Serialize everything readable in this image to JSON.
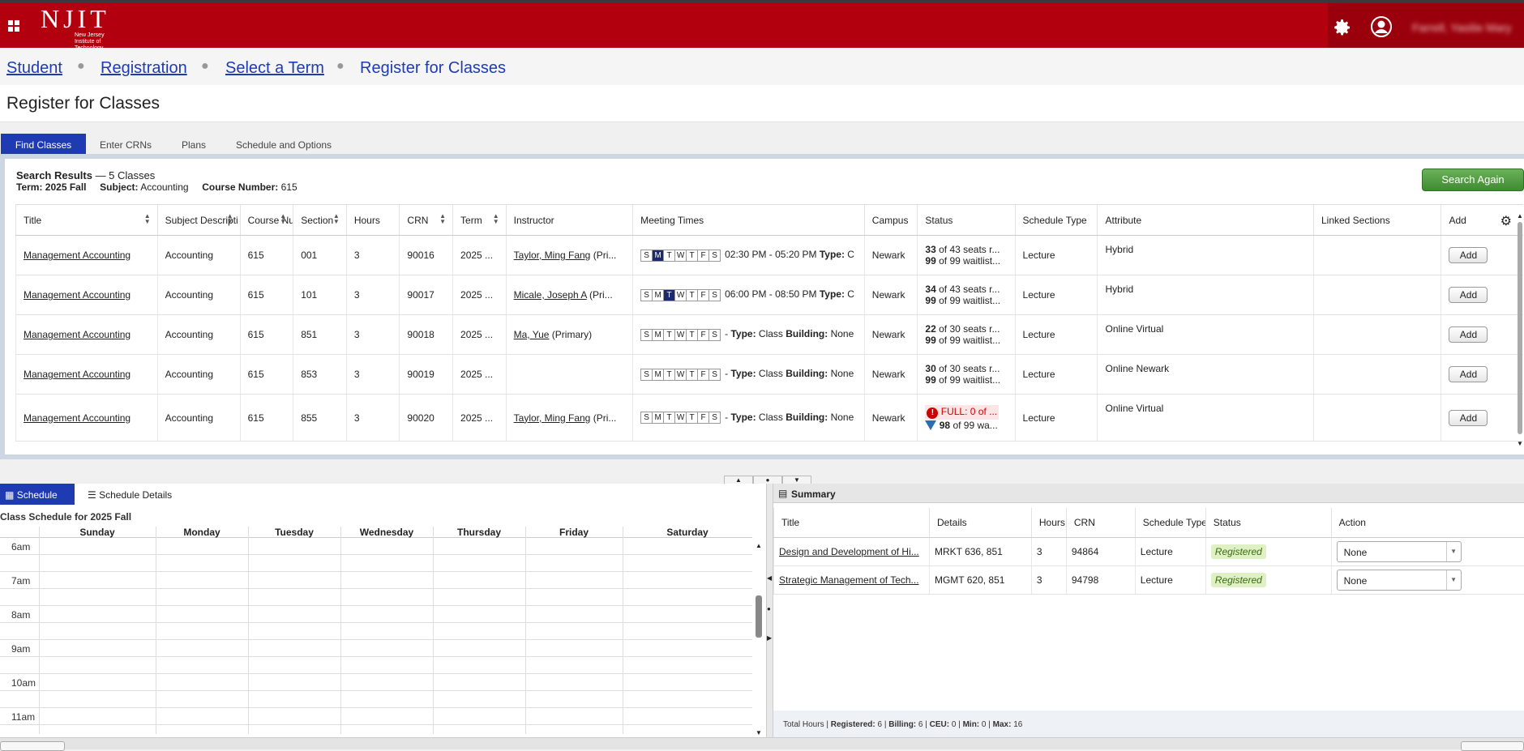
{
  "header": {
    "logo_text": "NJIT",
    "logo_subtext": "New Jersey Institute of Technology",
    "user_name": "Farrell, Yasilie Mary",
    "icons": [
      "apps-grid-icon",
      "gear-icon",
      "user-icon"
    ]
  },
  "breadcrumb": {
    "items": [
      "Student",
      "Registration",
      "Select a Term",
      "Register for Classes"
    ]
  },
  "page_title": "Register for Classes",
  "tabs": [
    "Find Classes",
    "Enter CRNs",
    "Plans",
    "Schedule and Options"
  ],
  "results": {
    "title": "Search Results",
    "count": "— 5 Classes",
    "term_label": "Term:",
    "term_value": "2025 Fall",
    "subject_label": "Subject:",
    "subject_value": "Accounting",
    "course_label": "Course Number:",
    "course_value": "615",
    "search_again": "Search Again",
    "columns": [
      "Title",
      "Subject Descripti",
      "Course Nu",
      "Section",
      "Hours",
      "CRN",
      "Term",
      "Instructor",
      "Meeting Times",
      "Campus",
      "Status",
      "Schedule Type",
      "Attribute",
      "Linked Sections",
      "Add"
    ],
    "rows": [
      {
        "title": "Management Accounting",
        "subject": "Accounting",
        "course": "615",
        "section": "001",
        "hours": "3",
        "crn": "90016",
        "term": "2025 ...",
        "instructor": "Taylor, Ming Fang",
        "instructor_role": "(Pri...",
        "days_on": [
          "M"
        ],
        "meeting": "02:30 PM - 05:20 PM",
        "meeting_type": "Type:",
        "meeting_rest": " C",
        "campus": "Newark",
        "seats_num": "33",
        "seats": " of 43 seats r...",
        "wait_num": "99",
        "wait": " of 99 waitlist...",
        "full": false,
        "sched_type": "Lecture",
        "attribute": "Hybrid",
        "add": "Add"
      },
      {
        "title": "Management Accounting",
        "subject": "Accounting",
        "course": "615",
        "section": "101",
        "hours": "3",
        "crn": "90017",
        "term": "2025 ...",
        "instructor": "Micale, Joseph A",
        "instructor_role": "(Pri...",
        "days_on": [
          "T"
        ],
        "meeting": "06:00 PM - 08:50 PM",
        "meeting_type": "Type:",
        "meeting_rest": " C",
        "campus": "Newark",
        "seats_num": "34",
        "seats": " of 43 seats r...",
        "wait_num": "99",
        "wait": " of 99 waitlist...",
        "full": false,
        "sched_type": "Lecture",
        "attribute": "Hybrid",
        "add": "Add"
      },
      {
        "title": "Management Accounting",
        "subject": "Accounting",
        "course": "615",
        "section": "851",
        "hours": "3",
        "crn": "90018",
        "term": "2025 ...",
        "instructor": "Ma, Yue",
        "instructor_role": "(Primary)",
        "days_on": [],
        "meeting": "-",
        "meeting_type": "Type:",
        "meeting_rest": " Class  ",
        "building": "Building:",
        "building_rest": " None",
        "campus": "Newark",
        "seats_num": "22",
        "seats": " of 30 seats r...",
        "wait_num": "99",
        "wait": " of 99 waitlist...",
        "full": false,
        "sched_type": "Lecture",
        "attribute": "Online Virtual",
        "add": "Add"
      },
      {
        "title": "Management Accounting",
        "subject": "Accounting",
        "course": "615",
        "section": "853",
        "hours": "3",
        "crn": "90019",
        "term": "2025 ...",
        "instructor": "",
        "instructor_role": "",
        "days_on": [],
        "meeting": "-",
        "meeting_type": "Type:",
        "meeting_rest": " Class  ",
        "building": "Building:",
        "building_rest": " None",
        "campus": "Newark",
        "seats_num": "30",
        "seats": " of 30 seats r...",
        "wait_num": "99",
        "wait": " of 99 waitlist...",
        "full": false,
        "sched_type": "Lecture",
        "attribute": "Online Newark",
        "add": "Add"
      },
      {
        "title": "Management Accounting",
        "subject": "Accounting",
        "course": "615",
        "section": "855",
        "hours": "3",
        "crn": "90020",
        "term": "2025 ...",
        "instructor": "Taylor, Ming Fang",
        "instructor_role": "(Pri...",
        "days_on": [],
        "meeting": "-",
        "meeting_type": "Type:",
        "meeting_rest": " Class  ",
        "building": "Building:",
        "building_rest": " None",
        "campus": "Newark",
        "full_text": "FULL: 0 of ...",
        "wait_num": "98",
        "wait": " of 99 wa...",
        "full": true,
        "sched_type": "Lecture",
        "attribute": "Online Virtual",
        "add": "Add"
      }
    ]
  },
  "day_letters": [
    "S",
    "M",
    "T",
    "W",
    "T",
    "F",
    "S"
  ],
  "schedule": {
    "tab_schedule": "Schedule",
    "tab_details": "Schedule Details",
    "title": "Class Schedule for 2025 Fall",
    "days": [
      "Sunday",
      "Monday",
      "Tuesday",
      "Wednesday",
      "Thursday",
      "Friday",
      "Saturday"
    ],
    "hours": [
      "6am",
      "7am",
      "8am",
      "9am",
      "10am",
      "11am"
    ]
  },
  "summary": {
    "title": "Summary",
    "columns": [
      "Title",
      "Details",
      "Hours",
      "CRN",
      "Schedule Type",
      "Status",
      "Action"
    ],
    "rows": [
      {
        "title": "Design and Development of Hi...",
        "details": "MRKT 636, 851",
        "hours": "3",
        "crn": "94864",
        "sched_type": "Lecture",
        "status": "Registered",
        "action": "None"
      },
      {
        "title": "Strategic Management of Tech...",
        "details": "MGMT 620, 851",
        "hours": "3",
        "crn": "94798",
        "sched_type": "Lecture",
        "status": "Registered",
        "action": "None"
      }
    ],
    "footer": {
      "total_label": "Total Hours |",
      "registered_label": "Registered:",
      "registered": "6",
      "billing_label": "Billing:",
      "billing": "6",
      "ceu_label": "CEU:",
      "ceu": "0",
      "min_label": "Min:",
      "min": "0",
      "max_label": "Max:",
      "max": "16"
    }
  },
  "colors": {
    "header_red": "#b3000e",
    "tab_blue": "#1f3bb3",
    "search_green": "#4a9a3c"
  }
}
